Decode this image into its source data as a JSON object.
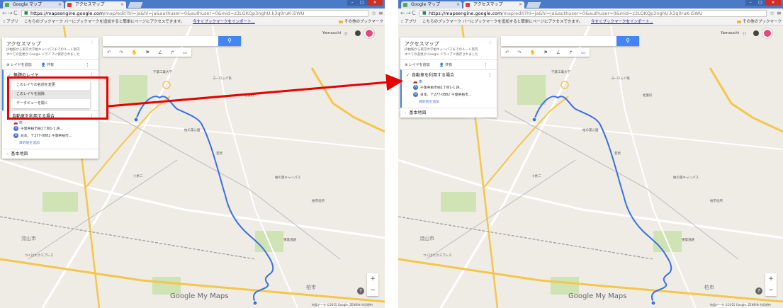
{
  "browser": {
    "tabs": [
      {
        "label": "Google マップ"
      },
      {
        "label": "アクセスマップ"
      }
    ],
    "url": {
      "host": "https://mapsengine.google.com",
      "path": "/map/edit?hl=ja&hl=ja&authuser=0&authuser=0&mid=z3LGKQp3nghU.k3q0ruK-i5WU"
    },
    "bookmarks": {
      "apps": "アプリ",
      "prompt": "こちらのブックマーク バーにブックマークを追加すると簡単にページにアクセスできます。",
      "import_link": "今すぐブックマークをインポート...",
      "other": "その他のブックマーク"
    }
  },
  "account": {
    "user": "Yamauchi"
  },
  "map": {
    "title": "アクセスマップ",
    "description": "JR柏駅から東京大学柏キャンパスまでのルート案内",
    "saved": "すべての変更が Google ドライブに保存されました",
    "add_layer": "レイヤを追加",
    "share": "共有",
    "untitled_layer": "無題のレイヤ",
    "menu": [
      {
        "label": "このレイヤの名前を変更"
      },
      {
        "label": "このレイヤを削除"
      },
      {
        "label": "データビューを開く"
      }
    ],
    "route_layer": "自動車を利用する場合",
    "mode": "車",
    "stops": [
      {
        "badge": "A",
        "left_text": "千葉県柏市柏1丁目1-1 JR...",
        "right_text": "千葉県柏市柏1丁目1-1 JR..."
      },
      {
        "badge": "B",
        "left_text": "日本、〒277-0882 千葉県柏市...",
        "right_text": "日本、〒277-0882 千葉県柏市..."
      }
    ],
    "add_destination": "目的地を追加",
    "base_map": "基本地図",
    "brand": "Google My Maps",
    "footer": "地図データ ©2015 Google, ZENRIN 利用規約",
    "city_labels": [
      "流山市",
      "柏市"
    ]
  },
  "colors": {
    "route": "#3c6fe0",
    "annotation": "#e60000",
    "accent": "#4285f4"
  }
}
